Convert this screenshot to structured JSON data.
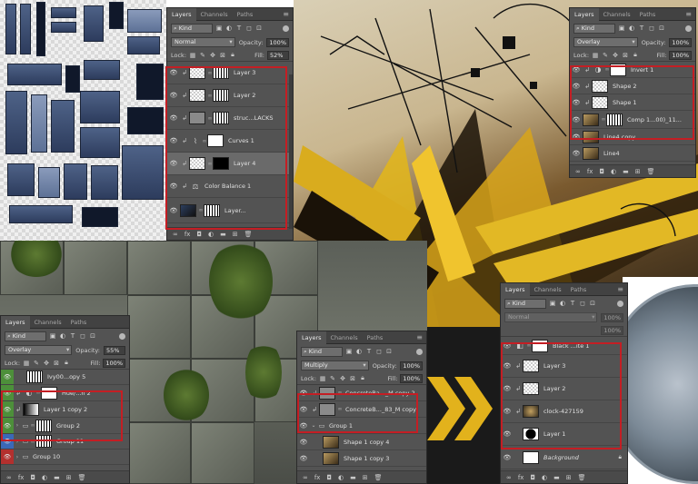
{
  "tabs": {
    "layers": "Layers",
    "channels": "Channels",
    "paths": "Paths"
  },
  "common": {
    "kind": "Kind",
    "opacity_label": "Opacity:",
    "fill_label": "Fill:",
    "lock_label": "Lock:"
  },
  "panel1": {
    "blend": "Normal",
    "opacity": "100%",
    "fill": "52%",
    "layers": [
      "Layer 3",
      "Layer 2",
      "struc...LACKS",
      "Curves 1",
      "Layer 4",
      "Color Balance 1",
      "Layer..."
    ]
  },
  "panel2": {
    "blend": "Overlay",
    "opacity": "100%",
    "fill": "100%",
    "layers": [
      "Invert 1",
      "Shape 2",
      "Shape 1",
      "Comp 1...00)_11...",
      "Line4 copy",
      "Line4"
    ]
  },
  "panel3": {
    "blend": "Overlay",
    "opacity": "55%",
    "fill": "100%",
    "layers": [
      "Ivy00...opy 5",
      "Hue/...n 2",
      "Layer 1 copy 2",
      "Group 2",
      "Group 11",
      "Group 10"
    ]
  },
  "panel4": {
    "blend": "Multiply",
    "opacity": "100%",
    "fill": "100%",
    "layers": [
      "ConcreteBa..._M copy 2",
      "ConcreteB..._83_M copy",
      "Group 1",
      "Shape 1 copy 4",
      "Shape 1 copy 3"
    ]
  },
  "panel5": {
    "blend": "Normal",
    "opacity": "100%",
    "fill": "100%",
    "layers": [
      "Black ...ite 1",
      "Layer 3",
      "Layer 2",
      "clock-427159",
      "Layer 1",
      "Background"
    ]
  },
  "colors": {
    "highlight": "#c41e24",
    "panel_bg": "#535353",
    "tab_bg": "#424242"
  }
}
